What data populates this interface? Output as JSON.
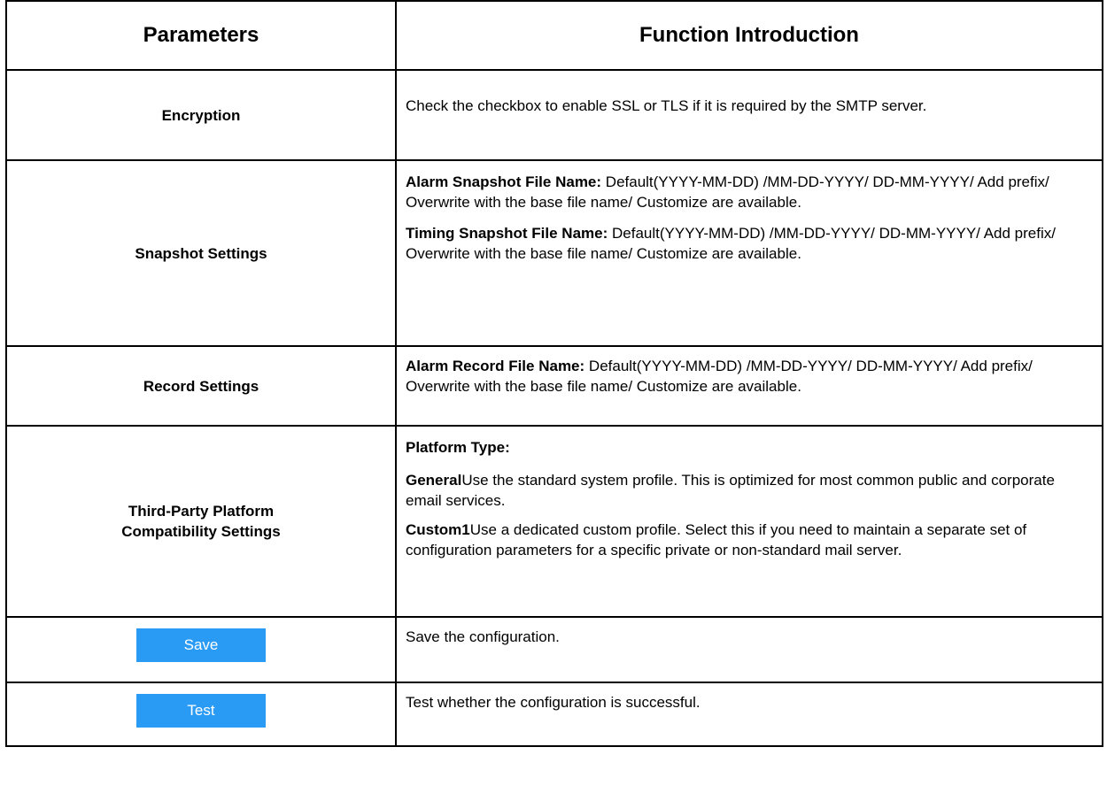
{
  "header": {
    "col1": "Parameters",
    "col2": "Function Introduction"
  },
  "rows": {
    "encryption": {
      "name": "Encryption",
      "desc": "Check the checkbox to enable SSL or TLS if it is required by the SMTP server."
    },
    "snapshot": {
      "name": "Snapshot Settings",
      "alarm_label": "Alarm Snapshot File Name:",
      "alarm_text": " Default(YYYY-MM-DD) /MM-DD-YYYY/ DD-MM-YYYY/ Add prefix/ Overwrite with the base file name/ Customize are available.",
      "timing_label": "Timing Snapshot File Name:",
      "timing_text": " Default(YYYY-MM-DD) /MM-DD-YYYY/ DD-MM-YYYY/ Add prefix/ Overwrite with the base file name/ Customize are available."
    },
    "record": {
      "name": "Record Settings",
      "alarm_label": "Alarm Record File Name:",
      "alarm_text": " Default(YYYY-MM-DD) /MM-DD-YYYY/ DD-MM-YYYY/ Add prefix/ Overwrite with the base file name/ Customize are available."
    },
    "third_party": {
      "name_line1": "Third-Party Platform",
      "name_line2": "Compatibility Settings",
      "platform_label": "Platform Type:",
      "general_label": "General",
      "general_text": "Use the standard system profile. This is optimized for most common public and corporate email services.",
      "custom_label": "Custom1",
      "custom_text": "Use a dedicated custom profile. Select this if you need to maintain a separate set of configuration parameters for a specific private or non-standard mail server."
    },
    "save": {
      "button": "Save",
      "desc": "Save the configuration."
    },
    "test": {
      "button": "Test",
      "desc": "Test whether the configuration is successful."
    }
  },
  "colors": {
    "button_bg": "#2a9bf5",
    "button_text": "#ffffff",
    "border": "#000000"
  }
}
